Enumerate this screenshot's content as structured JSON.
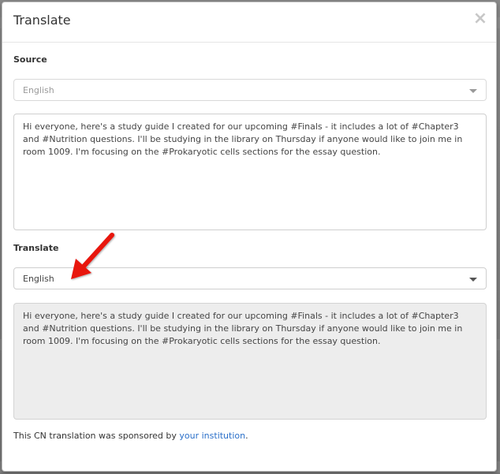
{
  "dialog": {
    "title": "Translate",
    "close_glyph": "×"
  },
  "source": {
    "label": "Source",
    "language": "English",
    "text": "Hi everyone, here's a study guide I created for our upcoming #Finals - it includes a lot of #Chapter3 and #Nutrition questions. I'll be studying in the library on Thursday if anyone would like to join me in room 1009. I'm focusing on the #Prokaryotic cells sections for the essay question."
  },
  "translate": {
    "label": "Translate",
    "language": "English",
    "text": "Hi everyone, here's a study guide I created for our upcoming #Finals - it includes a lot of #Chapter3 and #Nutrition questions. I'll be studying in the library on Thursday if anyone would like to join me in room 1009. I'm focusing on the #Prokaryotic cells sections for the essay question."
  },
  "footer": {
    "prefix": "This CN translation was sponsored by ",
    "link_text": "your institution",
    "suffix": "."
  },
  "annotation": {
    "arrow_color": "#e8140f"
  },
  "colors": {
    "link": "#2a6fc9",
    "readonly_bg": "#ededed"
  }
}
